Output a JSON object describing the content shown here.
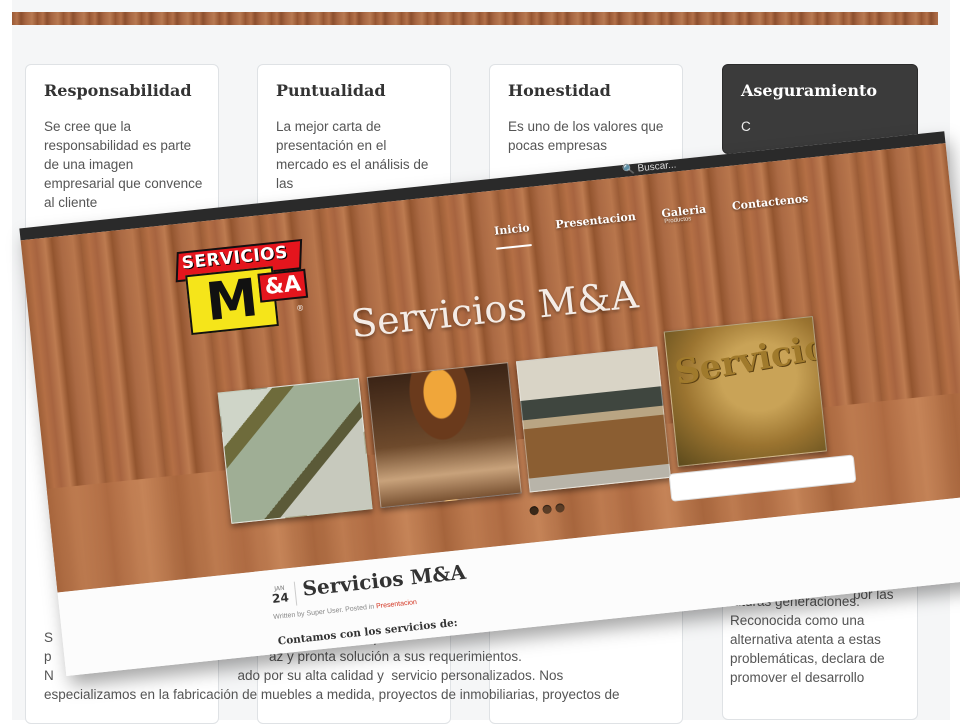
{
  "background": {
    "cards": [
      {
        "title": "Responsabilidad",
        "text": "Se cree que la responsabilidad es parte de una imagen empresarial que convence al cliente"
      },
      {
        "title": "Puntualidad",
        "text": "La mejor carta de presentación en el mercado es el análisis de las"
      },
      {
        "title": "Honestidad",
        "text": "Es uno de los valores que pocas empresas"
      },
      {
        "title": "Aseguramiento",
        "text": "C"
      }
    ],
    "right_column_text": "futuras generaciones. Reconocida como una alternativa atenta a estas problemáticas, declara de promover el desarrollo",
    "right_column_partial": "por las",
    "bottom_text_lines": [
      "S                                                                    endedora que",
      "p                                                          az y pronta solución a sus requerimientos.",
      "N                                                 ado por su alta calidad y  servicio personalizados. Nos",
      "especializamos en la fabricación de muebles a medida, proyectos de inmobiliarias, proyectos de"
    ]
  },
  "screenshot": {
    "logo": {
      "top": "SERVICIOS",
      "letter": "M",
      "amp": "&A",
      "mark": "®"
    },
    "search_label": "Buscar...",
    "nav": [
      {
        "label": "Inicio",
        "sub": ""
      },
      {
        "label": "Presentacion",
        "sub": ""
      },
      {
        "label": "Galeria",
        "sub": "Productos"
      },
      {
        "label": "Contactenos",
        "sub": ""
      }
    ],
    "hero_title": "Servicios M&A",
    "photo4_text": "Servicios M&A",
    "slider_dots": 3,
    "post": {
      "month": "JAN",
      "day": "24",
      "title": "Servicios M&A",
      "meta_prefix": "Written by Super User. Posted in",
      "meta_category": "Presentacion",
      "lead": "Contamos con los servicios de:"
    }
  }
}
